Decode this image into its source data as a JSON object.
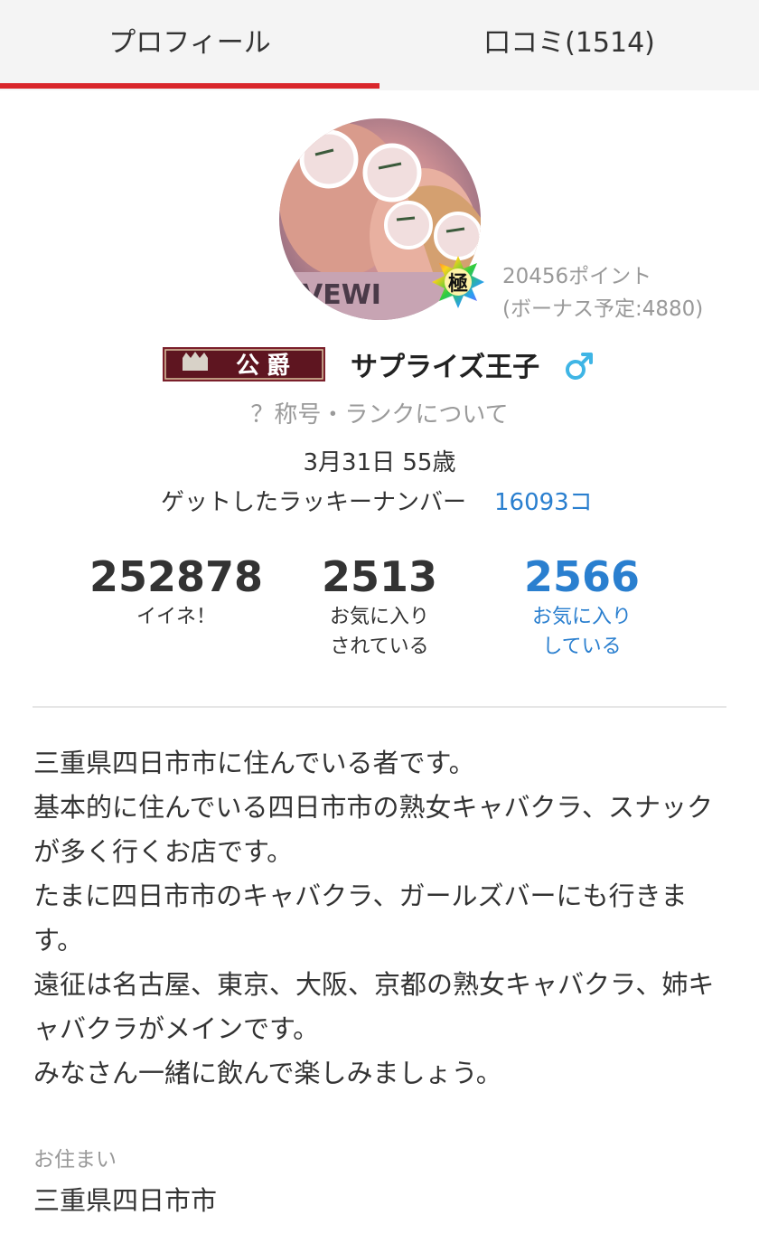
{
  "tabs": [
    {
      "label": "プロフィール",
      "active": true
    },
    {
      "label": "口コミ(1514)",
      "active": false
    }
  ],
  "colors": {
    "accent": "#d9262b",
    "link": "#2a7fcf",
    "muted": "#999999"
  },
  "profile": {
    "rank_badge_text": "極",
    "points": "20456ポイント",
    "bonus": "(ボーナス予定:4880)",
    "title_badge": "公爵",
    "name": "サプライズ王子",
    "gender_icon": "male-icon",
    "rank_link": "？称号・ランクについて",
    "birthday": "3月31日 55歳",
    "lucky_label": "ゲットしたラッキーナンバー",
    "lucky_count": "16093コ"
  },
  "stats": [
    {
      "value": "252878",
      "label_line1": "イイネ！",
      "label_line2": ""
    },
    {
      "value": "2513",
      "label_line1": "お気に入り",
      "label_line2": "されている"
    },
    {
      "value": "2566",
      "label_line1": "お気に入り",
      "label_line2": "している"
    }
  ],
  "bio": {
    "lines": [
      "三重県四日市市に住んでいる者です。",
      "基本的に住んでいる四日市市の熟女キャバクラ、スナックが多く行くお店です。",
      "たまに四日市市のキャバクラ、ガールズバーにも行きます。",
      "遠征は名古屋、東京、大阪、京都の熟女キャバクラ、姉キャバクラがメインです。",
      "みなさん一緒に飲んで楽しみましょう。"
    ]
  },
  "residence": {
    "label": "お住まい",
    "value": "三重県四日市市"
  }
}
